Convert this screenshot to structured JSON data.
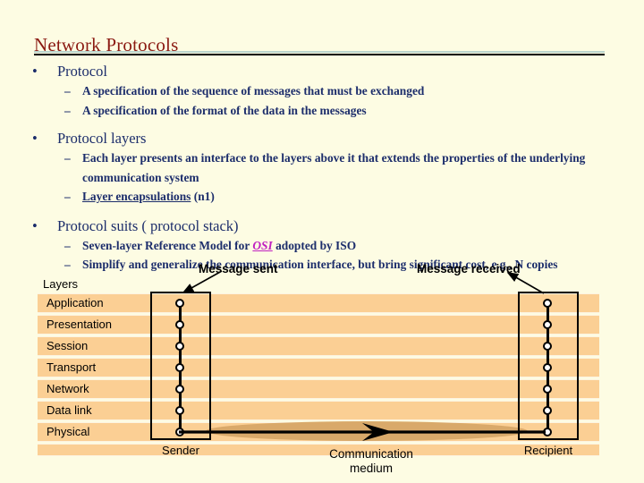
{
  "slide": {
    "title": "Network Protocols",
    "background_color": "#fdfce3",
    "title_color": "#8b1a12",
    "body_text_color": "#1c2d6b",
    "link_color": "#c020c0"
  },
  "body": {
    "bullet_marker": "•",
    "dash_marker": "–",
    "items": [
      {
        "label": "Protocol",
        "sub": [
          "A specification of the sequence of messages that must be exchanged",
          "A specification of the format of the data in the messages"
        ]
      },
      {
        "label": "Protocol layers",
        "sub": [
          "Each layer presents an interface to the layers above it that extends the properties of the underlying communication system",
          "Layer encapsulations (n1)"
        ]
      },
      {
        "label": "Protocol suits ( protocol stack)",
        "sub": [
          "Seven-layer Reference Model for OSI adopted by ISO",
          "Simplify and generalize the communication interface, but bring significant cost, e.g., N copies"
        ]
      }
    ],
    "sub_2_2_link_text": "Layer encapsulations",
    "sub_2_2_tail": " (n1)",
    "sub_3_1_pre": "Seven-layer Reference Model for ",
    "sub_3_1_link": "OSI",
    "sub_3_1_post": " adopted by ISO",
    "sub_3_2_text": "Simplify and generalize the communication interface, but bring significant cost, e.g., N copies"
  },
  "diagram": {
    "layers_caption": "Layers",
    "layers": [
      "Application",
      "Presentation",
      "Session",
      "Transport",
      "Network",
      "Data link",
      "Physical"
    ],
    "band_color": "#fbcf94",
    "medium_color": "#d9a96a",
    "sender_caption": "Sender",
    "recipient_caption": "Recipient",
    "message_sent_label": "Message sent",
    "message_received_label": "Message received",
    "medium_label_line1": "Communication",
    "medium_label_line2": "medium",
    "node_count": 7
  }
}
